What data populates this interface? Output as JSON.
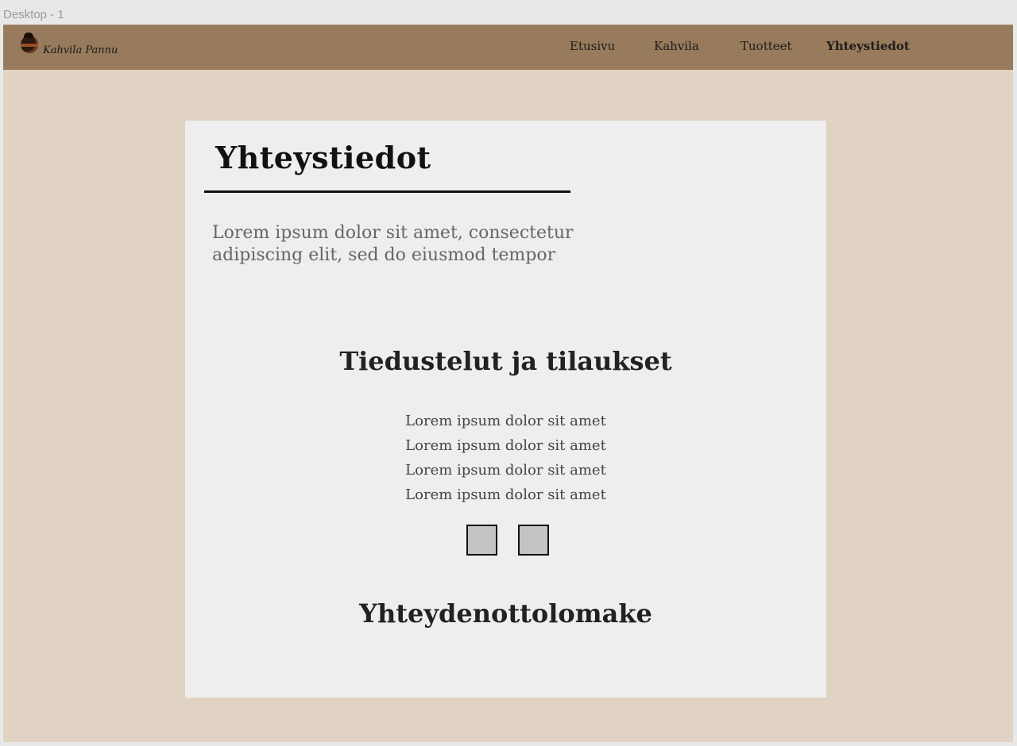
{
  "canvas": {
    "frame_label": "Desktop - 1"
  },
  "header": {
    "logo_text": "Kahvila Pannu",
    "nav": [
      {
        "label": "Etusivu",
        "active": false
      },
      {
        "label": "Kahvila",
        "active": false
      },
      {
        "label": "Tuotteet",
        "active": false
      },
      {
        "label": "Yhteystiedot",
        "active": true
      }
    ]
  },
  "main": {
    "title": "Yhteystiedot",
    "intro": "Lorem ipsum dolor sit amet, consectetur adipiscing elit, sed do eiusmod tempor",
    "inquiries": {
      "heading": "Tiedustelut ja tilaukset",
      "lines": [
        "Lorem ipsum dolor sit amet",
        "Lorem ipsum dolor sit amet",
        "Lorem ipsum dolor sit amet",
        "Lorem ipsum dolor sit amet"
      ]
    },
    "social_icons": [
      "social-icon-placeholder",
      "social-icon-placeholder"
    ],
    "form_heading": "Yhteydenottolomake"
  },
  "colors": {
    "navbar": "#987b5c",
    "background": "#e0d3c3",
    "card": "#eeeeee",
    "placeholder": "#c4c4c4"
  }
}
